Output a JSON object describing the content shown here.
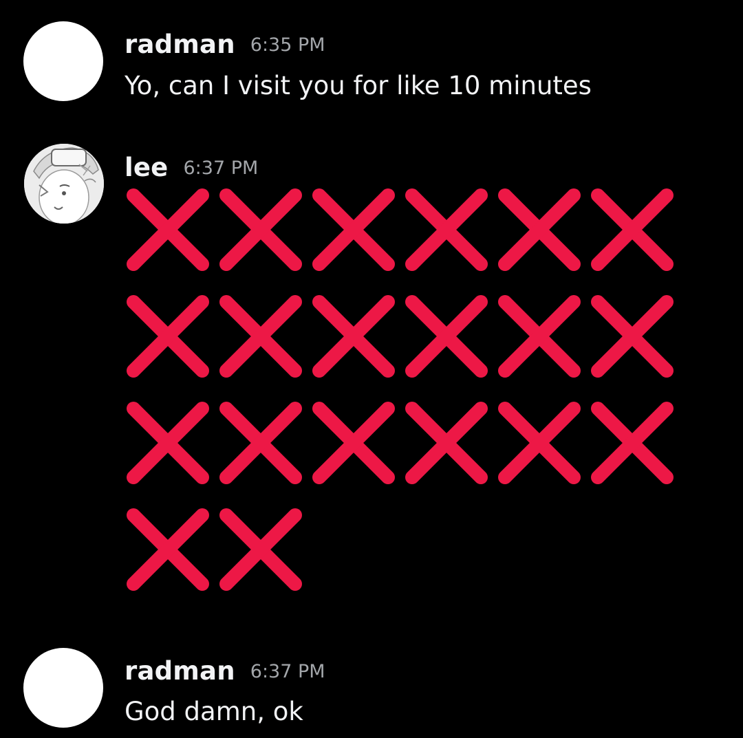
{
  "messages": [
    {
      "username": "radman",
      "timestamp": "6:35 PM",
      "text": "Yo, can I visit you for like 10 minutes",
      "avatar": "blank-white-avatar"
    },
    {
      "username": "lee",
      "timestamp": "6:37 PM",
      "emoji": "cross-mark-emoji",
      "emoji_count": 20,
      "emoji_color": "#ed1846",
      "avatar": "anime-character-avatar"
    },
    {
      "username": "radman",
      "timestamp": "6:37 PM",
      "text": "God damn, ok",
      "avatar": "blank-white-avatar"
    }
  ],
  "colors": {
    "background": "#000000",
    "username": "#f2f3f5",
    "timestamp": "#a3a6aa",
    "message_text": "#f2f3f5",
    "emoji_red": "#ed1846"
  }
}
